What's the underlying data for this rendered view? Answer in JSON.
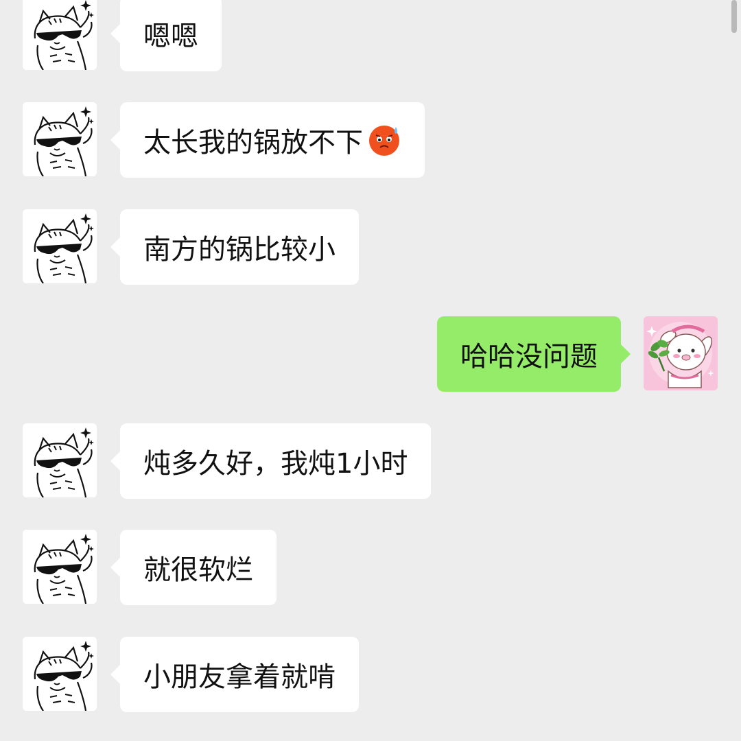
{
  "messages": [
    {
      "side": "in",
      "text": "嗯嗯",
      "emoji": null
    },
    {
      "side": "in",
      "text": "太长我的锅放不下",
      "emoji": "anxious-sweat-emoji-icon"
    },
    {
      "side": "in",
      "text": "南方的锅比较小",
      "emoji": null
    },
    {
      "side": "out",
      "text": "哈哈没问题",
      "emoji": null
    },
    {
      "side": "in",
      "text": "炖多久好，我炖1小时",
      "emoji": null
    },
    {
      "side": "in",
      "text": "就很软烂",
      "emoji": null
    },
    {
      "side": "in",
      "text": "小朋友拿着就啃",
      "emoji": null
    }
  ],
  "avatars": {
    "incoming": "sunglasses-cat-avatar-icon",
    "outgoing": "bunny-with-plant-avatar-icon"
  },
  "colors": {
    "background": "#ededed",
    "incoming_bubble": "#ffffff",
    "outgoing_bubble": "#95ec69",
    "text": "#111111"
  }
}
